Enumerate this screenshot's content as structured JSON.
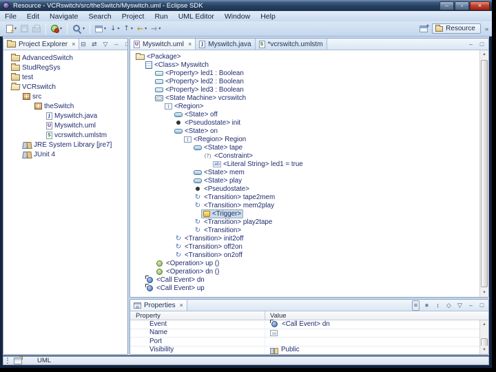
{
  "window": {
    "title": "Resource - VCRswitch/src/theSwitch/Myswitch.uml - Eclipse SDK",
    "controls": [
      {
        "name": "minimize",
        "glyph": "–"
      },
      {
        "name": "maximize",
        "glyph": "▫"
      },
      {
        "name": "close",
        "glyph": "×"
      }
    ]
  },
  "menu_bar": {
    "items": [
      "File",
      "Edit",
      "Navigate",
      "Search",
      "Project",
      "Run",
      "UML Editor",
      "Window",
      "Help"
    ]
  },
  "toolbar": {
    "overflow": "»",
    "buttons": [
      {
        "icon": "new-wizard-icon",
        "dropdown": true
      },
      {
        "icon": "save-icon",
        "disabled": true
      },
      {
        "icon": "print-icon",
        "disabled": true
      },
      {
        "separator": true
      },
      {
        "icon": "run-external-tools-icon",
        "dropdown": true
      },
      {
        "separator": true
      },
      {
        "icon": "search-icon",
        "dropdown": true
      },
      {
        "separator": true
      },
      {
        "icon": "open-element-icon",
        "dropdown": true
      },
      {
        "icon": "next-annotation-icon",
        "glyph": "↓",
        "dropdown": true
      },
      {
        "icon": "prev-annotation-icon",
        "glyph": "↑",
        "dropdown": true
      },
      {
        "icon": "back-icon",
        "glyph": "←",
        "dropdown": true
      },
      {
        "icon": "forward-icon",
        "glyph": "→",
        "dropdown": true
      }
    ]
  },
  "perspective": {
    "label": "Resource"
  },
  "project_explorer": {
    "title": "Project Explorer",
    "toolbar": [
      {
        "icon": "collapse-all-icon",
        "glyph": "⊟"
      },
      {
        "icon": "link-with-editor-icon",
        "glyph": "⇄"
      },
      {
        "icon": "view-menu-icon",
        "glyph": "▽"
      },
      {
        "icon": "minimize-icon",
        "glyph": "–"
      },
      {
        "icon": "maximize-icon",
        "glyph": "□"
      }
    ],
    "tree": [
      {
        "level": 0,
        "icon": "project-closed-icon",
        "label": "AdvancedSwitch"
      },
      {
        "level": 0,
        "icon": "project-closed-icon",
        "label": "StudRegSys"
      },
      {
        "level": 0,
        "icon": "project-closed-icon",
        "label": "test"
      },
      {
        "level": 0,
        "icon": "project-open-icon",
        "label": "VCRswitch"
      },
      {
        "level": 1,
        "icon": "source-folder-icon",
        "label": "src"
      },
      {
        "level": 2,
        "icon": "package-folder-icon",
        "label": "theSwitch"
      },
      {
        "level": 3,
        "icon": "java-file-icon",
        "label": "Myswitch.java"
      },
      {
        "level": 3,
        "icon": "uml-file-icon",
        "label": "Myswitch.uml"
      },
      {
        "level": 3,
        "icon": "umlstm-file-icon",
        "label": "vcrswitch.umlstm"
      },
      {
        "level": 1,
        "icon": "library-icon",
        "label": "JRE System Library [jre7]"
      },
      {
        "level": 1,
        "icon": "library-icon",
        "label": "JUnit 4"
      }
    ]
  },
  "editor": {
    "tabs": [
      {
        "icon": "uml-file-icon",
        "label": "Myswitch.uml",
        "active": true,
        "closable": true
      },
      {
        "icon": "java-file-icon",
        "label": "Myswitch.java",
        "active": false
      },
      {
        "icon": "umlstm-file-icon",
        "label": "*vcrswitch.umlstm",
        "active": false
      }
    ],
    "toolbar": [
      {
        "icon": "minimize-icon",
        "glyph": "–"
      },
      {
        "icon": "maximize-icon",
        "glyph": "□"
      }
    ],
    "tree": [
      {
        "level": 0,
        "icon": "uml-package-icon",
        "label": "<Package>"
      },
      {
        "level": 1,
        "icon": "uml-class-icon",
        "label": "<Class> Myswitch"
      },
      {
        "level": 2,
        "icon": "uml-property-icon",
        "label": "<Property> led1 : Boolean"
      },
      {
        "level": 2,
        "icon": "uml-property-icon",
        "label": "<Property> led2 : Boolean"
      },
      {
        "level": 2,
        "icon": "uml-property-icon",
        "label": "<Property> led3 : Boolean"
      },
      {
        "level": 2,
        "icon": "uml-statemachine-icon",
        "label": "<State Machine> vcrswitch"
      },
      {
        "level": 3,
        "icon": "uml-region-icon",
        "label": "<Region>"
      },
      {
        "level": 4,
        "icon": "uml-state-icon",
        "label": "<State> off"
      },
      {
        "level": 4,
        "icon": "uml-pseudostate-icon",
        "label": "<Pseudostate> init"
      },
      {
        "level": 4,
        "icon": "uml-state-icon",
        "label": "<State> on"
      },
      {
        "level": 5,
        "icon": "uml-region-icon",
        "label": "<Region> Region"
      },
      {
        "level": 6,
        "icon": "uml-state-icon",
        "label": "<State> tape"
      },
      {
        "level": 7,
        "icon": "uml-constraint-icon",
        "label": "<Constraint>"
      },
      {
        "level": 8,
        "icon": "uml-literal-string-icon",
        "label": "<Literal String> led1 = true"
      },
      {
        "level": 6,
        "icon": "uml-state-icon",
        "label": "<State> mem"
      },
      {
        "level": 6,
        "icon": "uml-state-icon",
        "label": "<State> play"
      },
      {
        "level": 6,
        "icon": "uml-pseudostate-icon",
        "label": "<Pseudostate>"
      },
      {
        "level": 6,
        "icon": "uml-transition-icon",
        "label": "<Transition> tape2mem"
      },
      {
        "level": 6,
        "icon": "uml-transition-icon",
        "label": "<Transition> mem2play"
      },
      {
        "level": 7,
        "icon": "uml-trigger-icon",
        "label": "<Trigger>",
        "selected": true
      },
      {
        "level": 6,
        "icon": "uml-transition-icon",
        "label": "<Transition> play2tape"
      },
      {
        "level": 6,
        "icon": "uml-transition-icon",
        "label": "<Transition>"
      },
      {
        "level": 4,
        "icon": "uml-transition-icon",
        "label": "<Transition> init2off"
      },
      {
        "level": 4,
        "icon": "uml-transition-icon",
        "label": "<Transition> off2on"
      },
      {
        "level": 4,
        "icon": "uml-transition-icon",
        "label": "<Transition> on2off"
      },
      {
        "level": 2,
        "icon": "uml-operation-icon",
        "label": "<Operation> up ()"
      },
      {
        "level": 2,
        "icon": "uml-operation-icon",
        "label": "<Operation> dn ()"
      },
      {
        "level": 1,
        "icon": "uml-callevent-icon",
        "label": "<Call Event> dn"
      },
      {
        "level": 1,
        "icon": "uml-callevent-icon",
        "label": "<Call Event> up"
      }
    ]
  },
  "properties": {
    "title": "Properties",
    "columns": [
      "Property",
      "Value"
    ],
    "toolbar": [
      {
        "icon": "show-categories-icon",
        "glyph": "≡",
        "pressed": true
      },
      {
        "icon": "show-advanced-icon",
        "glyph": "∗"
      },
      {
        "icon": "restore-defaults-icon",
        "glyph": "↕"
      },
      {
        "icon": "pin-icon",
        "glyph": "◇"
      },
      {
        "icon": "view-menu-icon",
        "glyph": "▽"
      },
      {
        "icon": "minimize-icon",
        "glyph": "–"
      },
      {
        "icon": "maximize-icon",
        "glyph": "□"
      }
    ],
    "rows": [
      {
        "property": "Event",
        "value": "<Call Event> dn",
        "value_icon": "call-event-icon"
      },
      {
        "property": "Name",
        "value": "",
        "value_icon": "name-field-icon"
      },
      {
        "property": "Port",
        "value": "",
        "value_icon": null
      },
      {
        "property": "Visibility",
        "value": "Public",
        "value_icon": "visibility-icon"
      }
    ]
  },
  "status_bar": {
    "label": "UML"
  },
  "colors": {
    "titlebar": "#26415f",
    "chrome": "#c9d9ec",
    "tree_text": "#1e2a6e",
    "selection_bg": "#ccdbe8",
    "close_button": "#c24330"
  }
}
